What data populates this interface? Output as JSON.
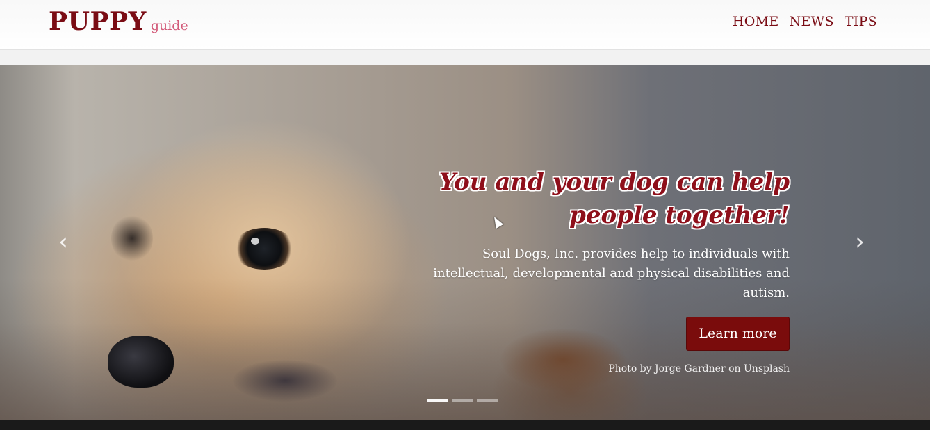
{
  "navbar": {
    "brand_main": "PUPPY",
    "brand_sub": "guide",
    "links": [
      {
        "label": "HOME"
      },
      {
        "label": "NEWS"
      },
      {
        "label": "TIPS"
      }
    ]
  },
  "carousel": {
    "prev_icon": "chevron-left-icon",
    "next_icon": "chevron-right-icon",
    "caption": {
      "title": "You and your dog can help people together!",
      "text": "Soul Dogs, Inc. provides help to individuals with intellectual, developmental and physical disabilities and autism.",
      "button_label": "Learn more",
      "credit_prefix": "Photo by",
      "credit_author": "Jorge Gardner",
      "credit_on": "on",
      "credit_site": "Unsplash"
    },
    "indicators": [
      {
        "active": true
      },
      {
        "active": false
      },
      {
        "active": false
      }
    ]
  },
  "colors": {
    "brand": "#7a0c14",
    "brand_accent": "#d35b7a",
    "button": "#7a0c0c"
  }
}
